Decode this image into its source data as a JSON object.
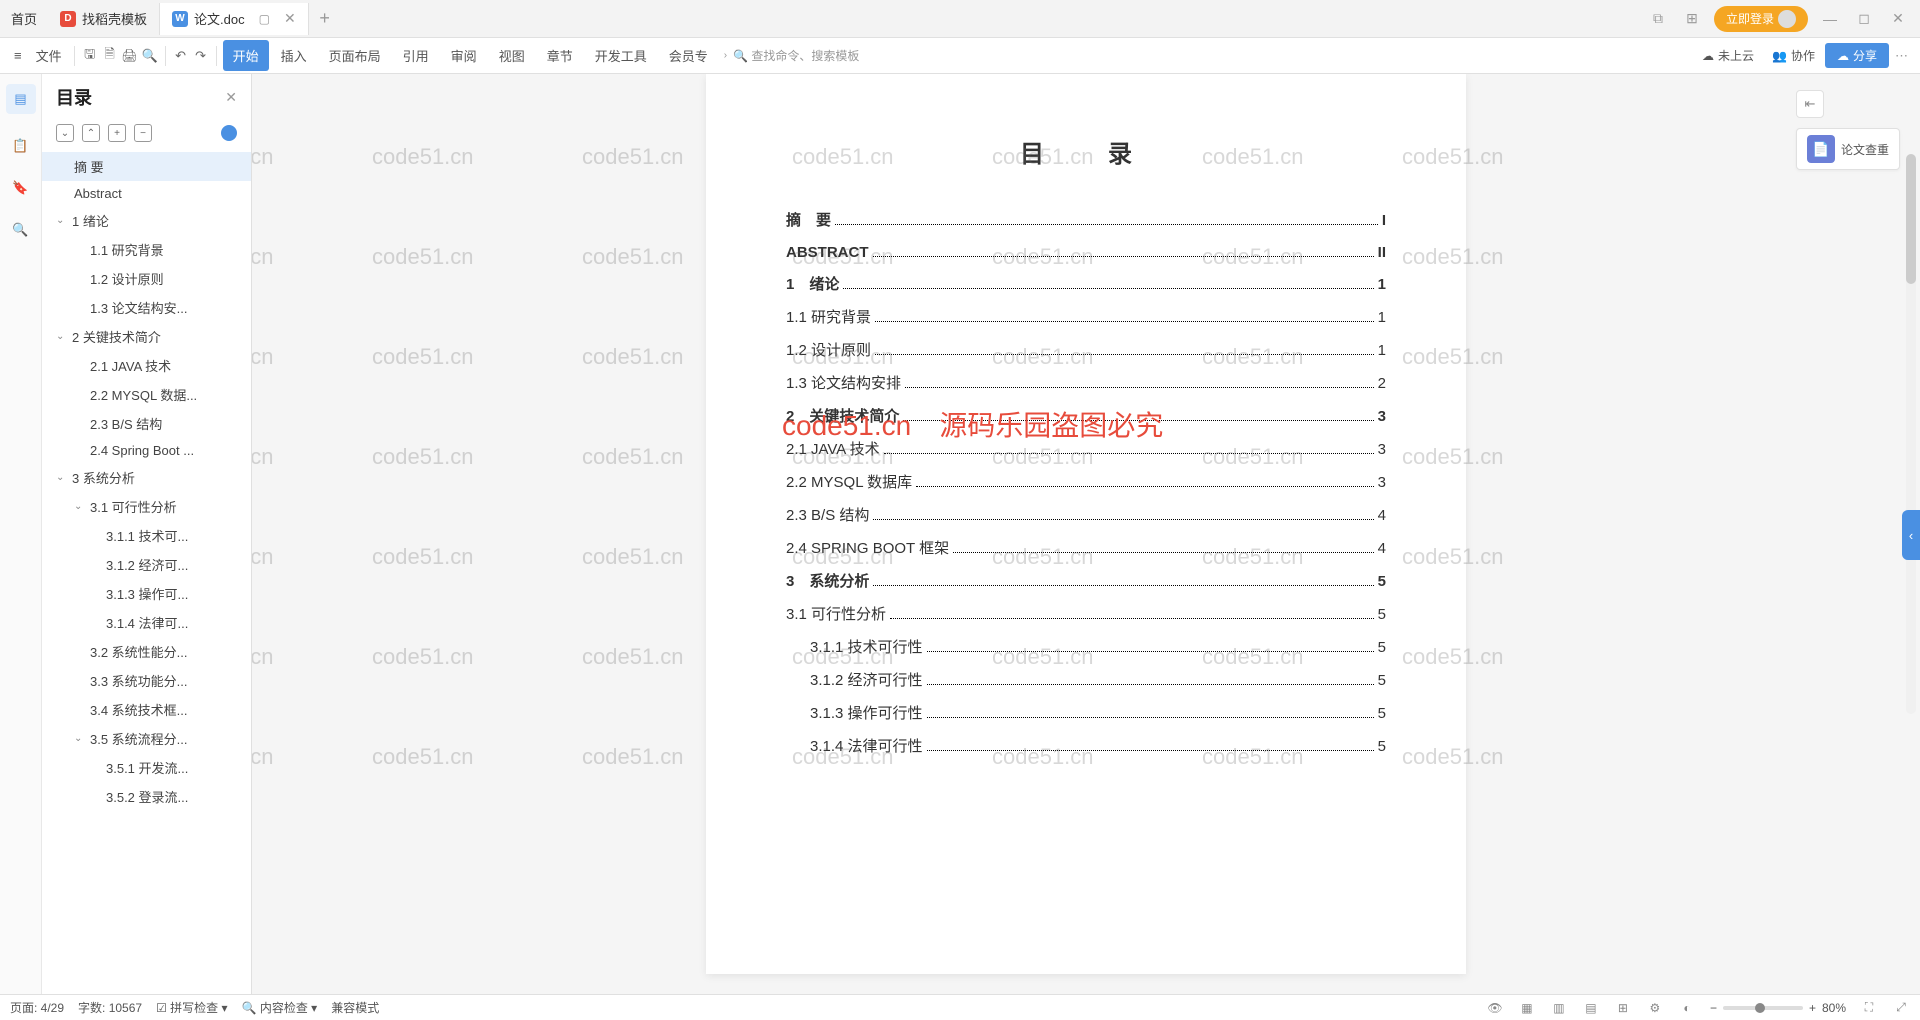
{
  "tabs": {
    "home": "首页",
    "items": [
      {
        "label": "找稻壳模板",
        "icon": "D"
      },
      {
        "label": "论文.doc",
        "icon": "W",
        "active": true
      }
    ],
    "login": "立即登录"
  },
  "ribbon": {
    "file": "文件",
    "menus": [
      "开始",
      "插入",
      "页面布局",
      "引用",
      "审阅",
      "视图",
      "章节",
      "开发工具",
      "会员专"
    ],
    "search_placeholder": "查找命令、搜索模板",
    "cloud": "未上云",
    "collab": "协作",
    "share": "分享"
  },
  "outline": {
    "title": "目录",
    "items": [
      {
        "label": "摘  要",
        "indent": 1,
        "selected": true
      },
      {
        "label": "Abstract",
        "indent": 1
      },
      {
        "label": "1  绪论",
        "indent": 0,
        "chevron": true
      },
      {
        "label": "1.1 研究背景",
        "indent": 2
      },
      {
        "label": "1.2 设计原则",
        "indent": 2
      },
      {
        "label": "1.3 论文结构安...",
        "indent": 2
      },
      {
        "label": "2  关键技术简介",
        "indent": 0,
        "chevron": true
      },
      {
        "label": "2.1 JAVA 技术",
        "indent": 2
      },
      {
        "label": "2.2 MYSQL 数据...",
        "indent": 2
      },
      {
        "label": "2.3 B/S 结构",
        "indent": 2
      },
      {
        "label": "2.4 Spring Boot ...",
        "indent": 2
      },
      {
        "label": "3  系统分析",
        "indent": 0,
        "chevron": true
      },
      {
        "label": "3.1 可行性分析",
        "indent": 1,
        "chevron": true
      },
      {
        "label": "3.1.1 技术可...",
        "indent": 3
      },
      {
        "label": "3.1.2 经济可...",
        "indent": 3
      },
      {
        "label": "3.1.3 操作可...",
        "indent": 3
      },
      {
        "label": "3.1.4 法律可...",
        "indent": 3
      },
      {
        "label": "3.2 系统性能分...",
        "indent": 2
      },
      {
        "label": "3.3 系统功能分...",
        "indent": 2
      },
      {
        "label": "3.4 系统技术框...",
        "indent": 2
      },
      {
        "label": "3.5 系统流程分...",
        "indent": 1,
        "chevron": true
      },
      {
        "label": "3.5.1 开发流...",
        "indent": 3
      },
      {
        "label": "3.5.2 登录流...",
        "indent": 3
      }
    ]
  },
  "document": {
    "page_title": "目　录",
    "toc": [
      {
        "label": "摘　要",
        "page": "I",
        "indent": 0,
        "bold": true
      },
      {
        "label": "ABSTRACT",
        "page": "II",
        "indent": 0,
        "bold": true
      },
      {
        "label": "1　绪论",
        "page": "1",
        "indent": 0,
        "bold": true
      },
      {
        "label": "1.1  研究背景",
        "page": "1",
        "indent": 0
      },
      {
        "label": "1.2  设计原则",
        "page": "1",
        "indent": 0
      },
      {
        "label": "1.3  论文结构安排",
        "page": "2",
        "indent": 0
      },
      {
        "label": "2　关键技术简介",
        "page": "3",
        "indent": 0,
        "bold": true
      },
      {
        "label": "2.1 JAVA 技术",
        "page": "3",
        "indent": 0
      },
      {
        "label": "2.2 MYSQL 数据库",
        "page": "3",
        "indent": 0
      },
      {
        "label": "2.3 B/S 结构",
        "page": "4",
        "indent": 0
      },
      {
        "label": "2.4 SPRING BOOT 框架",
        "page": "4",
        "indent": 0
      },
      {
        "label": "3　系统分析",
        "page": "5",
        "indent": 0,
        "bold": true
      },
      {
        "label": "3.1  可行性分析",
        "page": "5",
        "indent": 0
      },
      {
        "label": "3.1.1  技术可行性",
        "page": "5",
        "indent": 1
      },
      {
        "label": "3.1.2  经济可行性",
        "page": "5",
        "indent": 1
      },
      {
        "label": "3.1.3  操作可行性",
        "page": "5",
        "indent": 1
      },
      {
        "label": "3.1.4  法律可行性",
        "page": "5",
        "indent": 1
      }
    ],
    "watermark_text": "code51.cn",
    "watermark_red1": "code51.cn",
    "watermark_red2": "源码乐园盗图必究"
  },
  "right_panel": {
    "plagiarism": "论文查重"
  },
  "status": {
    "page": "页面: 4/29",
    "words": "字数: 10567",
    "spell": "拼写检查",
    "content": "内容检查",
    "compat": "兼容模式",
    "zoom": "80%"
  }
}
